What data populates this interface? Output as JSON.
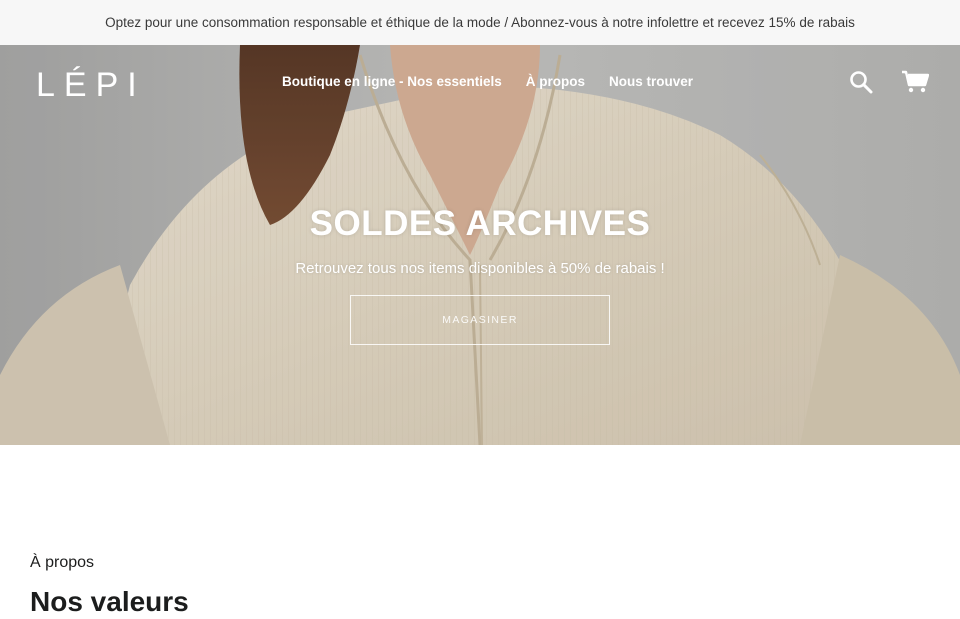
{
  "announcement": {
    "text": "Optez pour une consommation responsable et éthique de la mode / Abonnez-vous à notre infolettre et recevez 15% de rabais"
  },
  "header": {
    "logo_text": "LÉPI",
    "nav": [
      {
        "label": "Boutique en ligne - Nos essentiels"
      },
      {
        "label": "À propos"
      },
      {
        "label": "Nous trouver"
      }
    ],
    "icons": {
      "search": "search-icon",
      "cart": "cart-icon"
    }
  },
  "hero": {
    "title": "SOLDES ARCHIVES",
    "subtitle": "Retrouvez tous nos items disponibles à 50% de rabais !",
    "button_label": "MAGASINER"
  },
  "about": {
    "eyebrow": "À propos",
    "heading": "Nos valeurs"
  },
  "colors": {
    "announcement_bg": "#f7f7f7",
    "hero_fabric": "#e6dcc9",
    "text_dark": "#1c1d1d",
    "white": "#ffffff"
  }
}
